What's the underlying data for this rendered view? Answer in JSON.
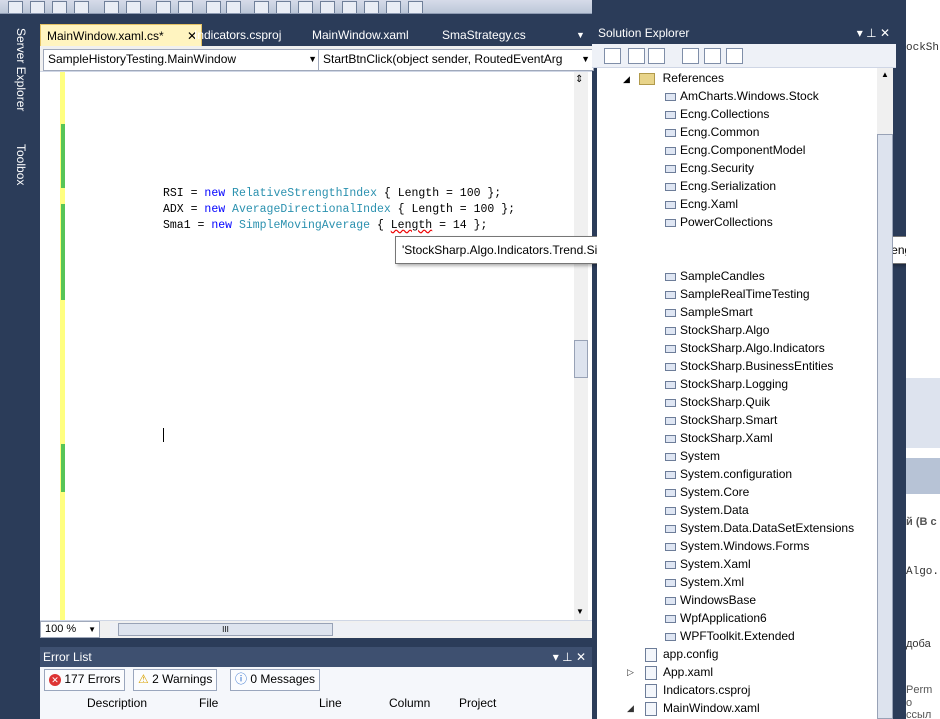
{
  "tabs": [
    {
      "label": "MainWindow.xaml.cs*",
      "close": "✕"
    },
    {
      "label": "Indicators.csproj"
    },
    {
      "label": "MainWindow.xaml"
    },
    {
      "label": "SmaStrategy.cs"
    }
  ],
  "left_strip": {
    "server_explorer": "Server Explorer",
    "toolbox": "Toolbox"
  },
  "nav": {
    "type_combo": "SampleHistoryTesting.MainWindow",
    "member_combo": "StartBtnClick(object sender, RoutedEventArg"
  },
  "code": {
    "line1": {
      "pre": "RSI = ",
      "kw": "new",
      "type": "RelativeStrengthIndex",
      "post": " { Length = 100 };"
    },
    "line2": {
      "pre": "ADX = ",
      "kw": "new",
      "type": "AverageDirectionalIndex",
      "post": " { Length = 100 };"
    },
    "line3": {
      "pre": "Sma1 = ",
      "kw": "new",
      "type": "SimpleMovingAverage",
      "mid": " { ",
      "err": "Length",
      "post": " = 14 };"
    }
  },
  "tooltip": "'StockSharp.Algo.Indicators.Trend.SimpleMovingAverage' does not contain a definition for 'Length'",
  "zoom": "100 %",
  "error_list": {
    "title": "Error List",
    "errors": "177 Errors",
    "warnings": "2 Warnings",
    "messages": "0 Messages",
    "columns": [
      "Description",
      "File",
      "Line",
      "Column",
      "Project"
    ]
  },
  "solution_explorer": {
    "title": "Solution Explorer",
    "references_label": "References",
    "references": [
      "AmCharts.Windows.Stock",
      "Ecng.Collections",
      "Ecng.Common",
      "Ecng.ComponentModel",
      "Ecng.Security",
      "Ecng.Serialization",
      "Ecng.Xaml",
      "PowerCollections",
      "SampleCandles",
      "SampleRealTimeTesting",
      "SampleSmart",
      "StockSharp.Algo",
      "StockSharp.Algo.Indicators",
      "StockSharp.BusinessEntities",
      "StockSharp.Logging",
      "StockSharp.Quik",
      "StockSharp.Smart",
      "StockSharp.Xaml",
      "System",
      "System.configuration",
      "System.Core",
      "System.Data",
      "System.Data.DataSetExtensions",
      "System.Windows.Forms",
      "System.Xaml",
      "System.Xml",
      "WindowsBase",
      "WpfApplication6",
      "WPFToolkit.Extended"
    ],
    "files": [
      "app.config",
      "App.xaml",
      "Indicators.csproj",
      "MainWindow.xaml"
    ]
  },
  "bg_window": {
    "t1": "ockSh",
    "t2": "й (В с",
    "t3": "Algo.In",
    "t4": "доба",
    "t5": "Perm",
    "t6": "о ссыл"
  }
}
